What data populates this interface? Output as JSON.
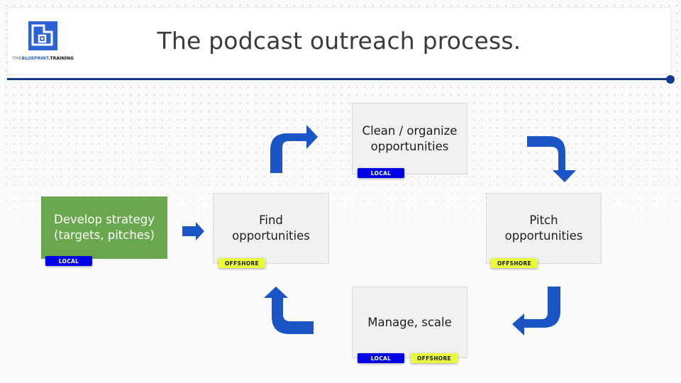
{
  "slide": {
    "title": "The podcast outreach process.",
    "logo": {
      "icon": "blueprint-logo-icon",
      "text_parts": [
        "THE",
        "BLUEPRINT",
        ".TRAINING"
      ]
    }
  },
  "colors": {
    "arrow": "#1a55c6",
    "rule": "#17398e",
    "strategy_box": "#6aa84f",
    "local_badge": "#0000e6",
    "offshore_badge": "#e9ff3b"
  },
  "steps": [
    {
      "id": "strategy",
      "line1": "Develop strategy",
      "line2": "(targets, pitches)",
      "badges": [
        "LOCAL"
      ]
    },
    {
      "id": "find",
      "line1": "Find",
      "line2": "opportunities",
      "badges": [
        "OFFSHORE"
      ]
    },
    {
      "id": "clean",
      "line1": "Clean / organize",
      "line2": "opportunities",
      "badges": [
        "LOCAL"
      ]
    },
    {
      "id": "pitch",
      "line1": "Pitch",
      "line2": "opportunities",
      "badges": [
        "OFFSHORE"
      ]
    },
    {
      "id": "manage",
      "line1": "Manage, scale",
      "line2": "",
      "badges": [
        "LOCAL",
        "OFFSHORE"
      ]
    }
  ],
  "arrows": [
    {
      "from": "strategy",
      "to": "find",
      "icon": "arrow-right-icon"
    },
    {
      "from": "find",
      "to": "clean",
      "icon": "arrow-turn-up-right-icon"
    },
    {
      "from": "clean",
      "to": "pitch",
      "icon": "arrow-turn-right-down-icon"
    },
    {
      "from": "pitch",
      "to": "manage",
      "icon": "arrow-turn-down-left-icon"
    },
    {
      "from": "manage",
      "to": "find",
      "icon": "arrow-turn-left-up-icon"
    }
  ]
}
